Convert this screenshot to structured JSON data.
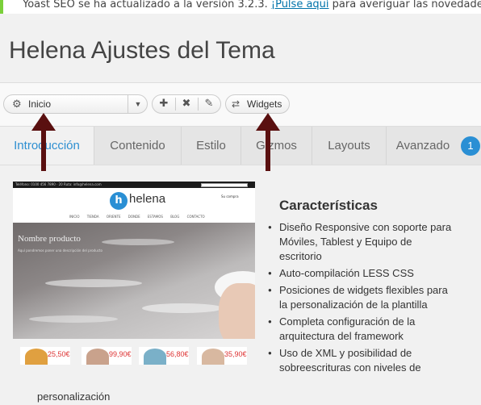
{
  "notice": {
    "before": "Yoast SEO se ha actualizado a la versión 3.2.3. ",
    "link": "¡Pulse aquí",
    "after": " para averiguar las novedades!"
  },
  "page_title": "Helena Ajustes del Tema",
  "toolbar": {
    "select_value": "Inicio",
    "widgets_label": "Widgets"
  },
  "tabs": [
    "Introducción",
    "Contenido",
    "Estilo",
    "Gizmos",
    "Layouts",
    "Avanzado"
  ],
  "tab_badge": "1",
  "preview": {
    "topbar_text": "Teléfono: 0100 456 7890 · 20 Ruta: info@helena.com",
    "search_placeholder": "Buscar productos...",
    "logo_letter": "h",
    "logo_text": "helena",
    "cart": "Su compra",
    "nav": "INICIO TIENDA ORIENTE DONDE ESTAMOS BLOG CONTACTO",
    "hero_title": "Nombre producto",
    "hero_desc": "Aquí pondremos poner una descripción del producto"
  },
  "products": [
    {
      "price": "25,50€",
      "color": "#e0a040"
    },
    {
      "price": "99,90€",
      "color": "#c9a28c"
    },
    {
      "price": "56,80€",
      "color": "#7ab0c8"
    },
    {
      "price": "35,90€",
      "color": "#d8b8a0"
    }
  ],
  "features": {
    "title": "Características",
    "items": [
      "Diseño Responsive con soporte para Móviles, Tablest y Equipo de escritorio",
      "Auto-compilación LESS CSS",
      "Posiciones de widgets flexibles para la personalización de la plantilla",
      "Completa configuración de la arquitectura del framework",
      "Uso de XML y posibilidad de sobreescrituras con niveles de"
    ],
    "continuation": "personalización"
  },
  "colors": {
    "accent": "#2e8fd1",
    "arrow": "#5a1010",
    "notice_border": "#7ad03a"
  }
}
